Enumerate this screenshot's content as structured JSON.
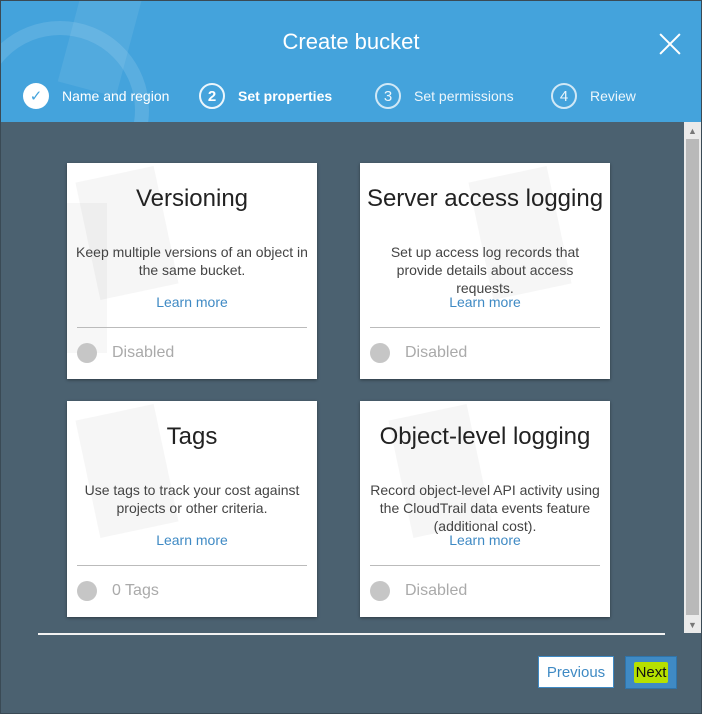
{
  "modal": {
    "title": "Create bucket",
    "close_icon": "close-icon"
  },
  "steps": [
    {
      "number": "✓",
      "label": "Name and region",
      "state": "done",
      "icon": "check-icon"
    },
    {
      "number": "2",
      "label": "Set properties",
      "state": "active"
    },
    {
      "number": "3",
      "label": "Set permissions",
      "state": "pending"
    },
    {
      "number": "4",
      "label": "Review",
      "state": "pending"
    }
  ],
  "cards": [
    {
      "title": "Versioning",
      "desc": "Keep multiple versions of an object in the same bucket.",
      "link": "Learn more",
      "status": "Disabled"
    },
    {
      "title": "Server access logging",
      "desc": "Set up access log records that provide details about access requests.",
      "link": "Learn more",
      "status": "Disabled"
    },
    {
      "title": "Tags",
      "desc": "Use tags to track your cost against projects or other criteria.",
      "link": "Learn more",
      "status": "0 Tags"
    },
    {
      "title": "Object-level logging",
      "desc": "Record object-level API activity using the CloudTrail data events feature (additional cost).",
      "link": "Learn more",
      "status": "Disabled"
    }
  ],
  "footer": {
    "previous_label": "Previous",
    "next_label": "Next"
  },
  "colors": {
    "header": "#44a3dc",
    "body": "#4b6170",
    "link": "#3f8ac4",
    "next_highlight": "#b6e000"
  }
}
